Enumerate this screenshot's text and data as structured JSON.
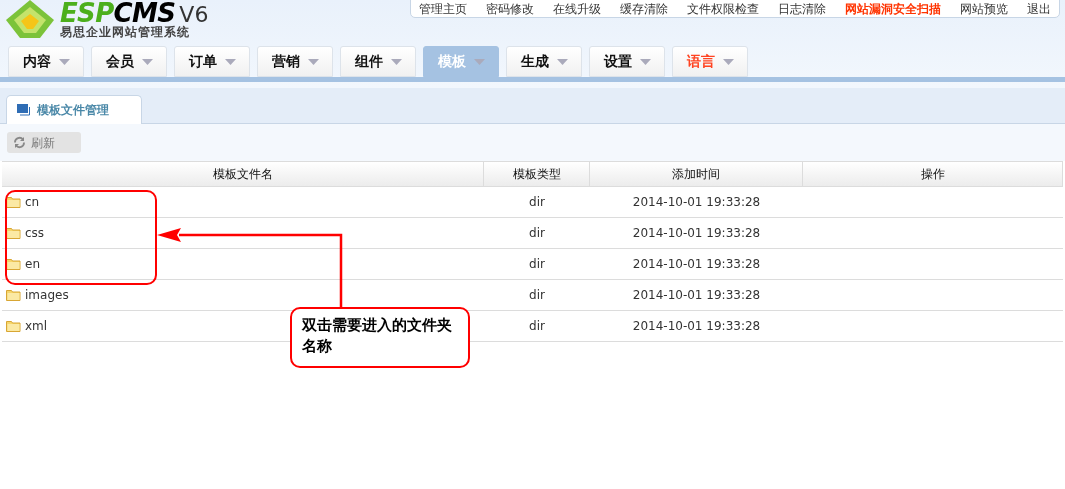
{
  "logo": {
    "brand_a": "ESP",
    "brand_b": "CMS",
    "version": "V6",
    "subtitle": "易思企业网站管理系统"
  },
  "top_links": [
    {
      "label": "管理主页",
      "warning": false
    },
    {
      "label": "密码修改",
      "warning": false
    },
    {
      "label": "在线升级",
      "warning": false
    },
    {
      "label": "缓存清除",
      "warning": false
    },
    {
      "label": "文件权限检查",
      "warning": false
    },
    {
      "label": "日志清除",
      "warning": false
    },
    {
      "label": "网站漏洞安全扫描",
      "warning": true
    },
    {
      "label": "网站预览",
      "warning": false
    },
    {
      "label": "退出",
      "warning": false
    }
  ],
  "nav": [
    {
      "label": "内容",
      "selected": false,
      "warning": false
    },
    {
      "label": "会员",
      "selected": false,
      "warning": false
    },
    {
      "label": "订单",
      "selected": false,
      "warning": false
    },
    {
      "label": "营销",
      "selected": false,
      "warning": false
    },
    {
      "label": "组件",
      "selected": false,
      "warning": false
    },
    {
      "label": "模板",
      "selected": true,
      "warning": false
    },
    {
      "label": "生成",
      "selected": false,
      "warning": false
    },
    {
      "label": "设置",
      "selected": false,
      "warning": false
    },
    {
      "label": "语言",
      "selected": false,
      "warning": true
    }
  ],
  "panel_tab": {
    "label": "模板文件管理"
  },
  "toolbar": {
    "refresh": "刷新"
  },
  "table": {
    "columns": [
      "模板文件名",
      "模板类型",
      "添加时间",
      "操作"
    ],
    "rows": [
      {
        "name": "cn",
        "type": "dir",
        "time": "2014-10-01 19:33:28"
      },
      {
        "name": "css",
        "type": "dir",
        "time": "2014-10-01 19:33:28"
      },
      {
        "name": "en",
        "type": "dir",
        "time": "2014-10-01 19:33:28"
      },
      {
        "name": "images",
        "type": "dir",
        "time": "2014-10-01 19:33:28"
      },
      {
        "name": "xml",
        "type": "dir",
        "time": "2014-10-01 19:33:28"
      }
    ]
  },
  "annotation": {
    "text": "双击需要进入的文件夹名称"
  }
}
